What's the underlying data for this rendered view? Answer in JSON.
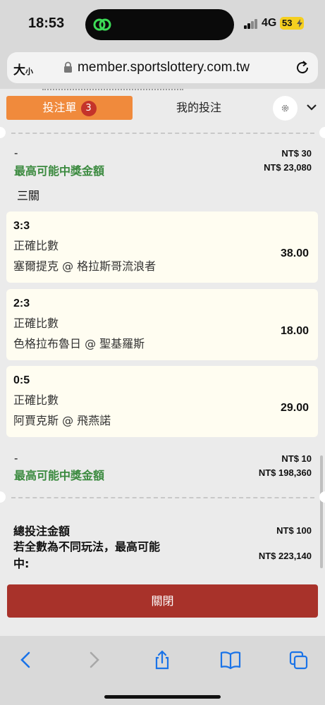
{
  "status": {
    "time": "18:53",
    "network": "4G",
    "battery": "53"
  },
  "browser": {
    "text_size_label": "大",
    "text_size_small": "小",
    "url": "member.sportslottery.com.tw"
  },
  "tabs": {
    "bet_slip": "投注單",
    "bet_slip_count": "3",
    "my_bets": "我的投注"
  },
  "groups": [
    {
      "dash": "-",
      "stake": "NT$ 30",
      "max_win_label": "最高可能中獎金額",
      "max_win": "NT$ 23,080"
    },
    {
      "dash": "-",
      "stake": "NT$ 10",
      "max_win_label": "最高可能中獎金額",
      "max_win": "NT$ 198,360"
    }
  ],
  "combo_label": "三關",
  "selections": [
    {
      "score": "3:3",
      "market": "正確比數",
      "teams": "塞爾提克 @ 格拉斯哥流浪者",
      "odds": "38.00"
    },
    {
      "score": "2:3",
      "market": "正確比數",
      "teams": "色格拉布魯日 @ 聖基羅斯",
      "odds": "18.00"
    },
    {
      "score": "0:5",
      "market": "正確比數",
      "teams": "阿賈克斯 @ 飛燕諾",
      "odds": "29.00"
    }
  ],
  "summary": {
    "total_stake_label": "總投注金額",
    "total_stake": "NT$ 100",
    "max_win_label": "若全數為不同玩法，最高可能中:",
    "max_win": "NT$ 223,140"
  },
  "close_button": "關閉",
  "icons": {
    "island": "link-app-icon",
    "lock": "lock-icon",
    "reload": "reload-icon",
    "settings": "gear-icon",
    "collapse": "chevron-down-icon",
    "back": "back-icon",
    "forward": "forward-icon",
    "share": "share-icon",
    "bookmarks": "bookmarks-icon",
    "tabs": "tabs-icon"
  },
  "colors": {
    "tab_active": "#f08a3c",
    "badge": "#c4332a",
    "win_green": "#3b8a3f",
    "close_button": "#a8322a",
    "ios_blue": "#1a73e8"
  }
}
